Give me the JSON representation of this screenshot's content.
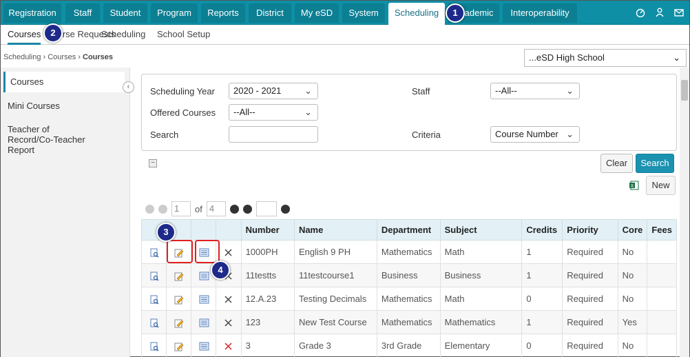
{
  "topnav": {
    "tabs": [
      "Registration",
      "Staff",
      "Student",
      "Program",
      "Reports",
      "District",
      "My eSD",
      "System",
      "Scheduling",
      "Academic",
      "Interoperability"
    ],
    "active": "Scheduling"
  },
  "subnav": {
    "items": [
      "Courses",
      "Course Requests",
      "Scheduling",
      "School Setup"
    ],
    "active": "Courses"
  },
  "breadcrumb": {
    "items": [
      "Scheduling",
      "Courses",
      "Courses"
    ]
  },
  "school_select": "...eSD High School",
  "sidebar": {
    "items": [
      "Courses",
      "Mini Courses",
      "Teacher of Record/Co-Teacher Report"
    ]
  },
  "filters": {
    "scheduling_year_label": "Scheduling Year",
    "scheduling_year_value": "2020 - 2021",
    "offered_courses_label": "Offered Courses",
    "offered_courses_value": "--All--",
    "search_label": "Search",
    "search_value": "",
    "staff_label": "Staff",
    "staff_value": "--All--",
    "criteria_label": "Criteria",
    "criteria_value": "Course Number"
  },
  "buttons": {
    "clear": "Clear",
    "search": "Search",
    "new": "New"
  },
  "pager": {
    "page": "1",
    "of_label": "of",
    "total": "4",
    "goto": ""
  },
  "table": {
    "headers": [
      "Number",
      "Name",
      "Department",
      "Subject",
      "Credits",
      "Priority",
      "Core",
      "Fees"
    ],
    "rows": [
      [
        "1000PH",
        "English 9 PH",
        "Mathematics",
        "Math",
        "1",
        "Required",
        "No",
        ""
      ],
      [
        "11testts",
        "11testcourse1",
        "Business",
        "Business",
        "1",
        "Required",
        "No",
        ""
      ],
      [
        "12.A.23",
        "Testing Decimals",
        "Mathematics",
        "Math",
        "0",
        "Required",
        "No",
        ""
      ],
      [
        "123",
        "New Test Course",
        "Mathematics",
        "Mathematics",
        "1",
        "Required",
        "Yes",
        ""
      ],
      [
        "3",
        "Grade 3",
        "3rd Grade",
        "Elementary",
        "0",
        "Required",
        "No",
        ""
      ]
    ]
  },
  "callouts": [
    "1",
    "2",
    "3",
    "4"
  ],
  "colors": {
    "brand": "#0f8fa6",
    "callout": "#1d2a8a",
    "highlight": "#e02020"
  }
}
